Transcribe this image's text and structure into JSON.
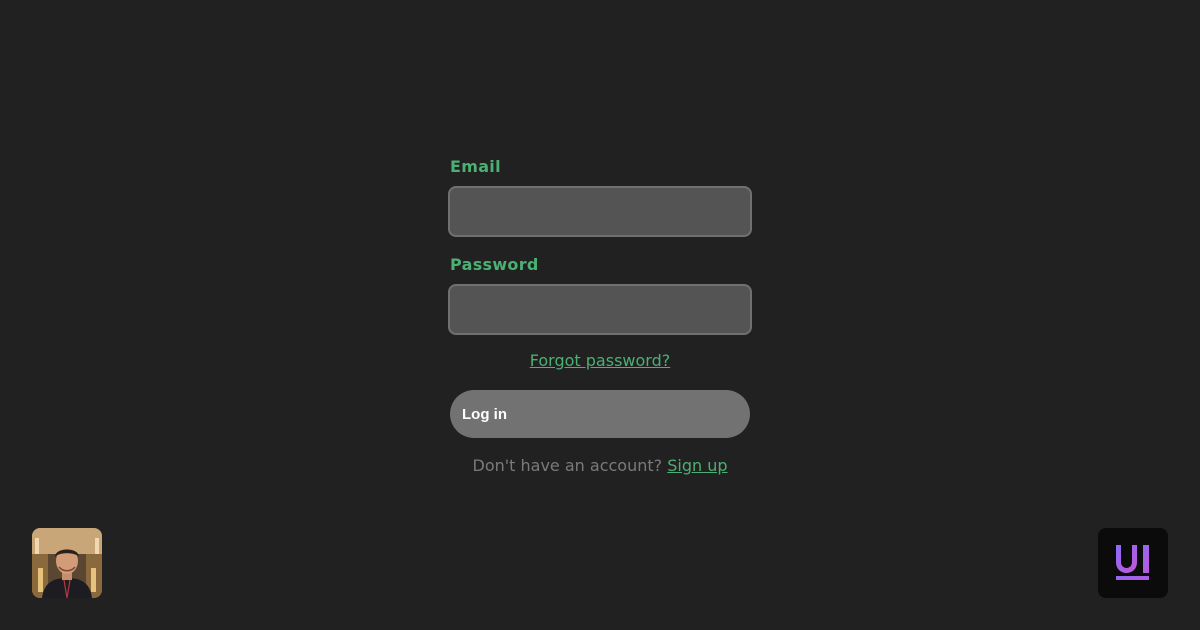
{
  "form": {
    "email_label": "Email",
    "email_value": "",
    "password_label": "Password",
    "password_value": "",
    "forgot_password_label": "Forgot password?",
    "login_button_label": "Log in",
    "signup_prompt": "Don't have an account?",
    "signup_link_label": "Sign up"
  },
  "branding": {
    "logo_text": "UI",
    "logo_icon": "ui-logo-icon",
    "avatar_icon": "user-avatar-photo"
  },
  "colors": {
    "background": "#212121",
    "accent": "#4caf73",
    "input_background": "#545454",
    "input_border": "#707070",
    "button_background": "#727272",
    "muted_text": "#7a7a7a",
    "logo_gradient_start": "#8b6cf6",
    "logo_gradient_end": "#c056d8"
  }
}
